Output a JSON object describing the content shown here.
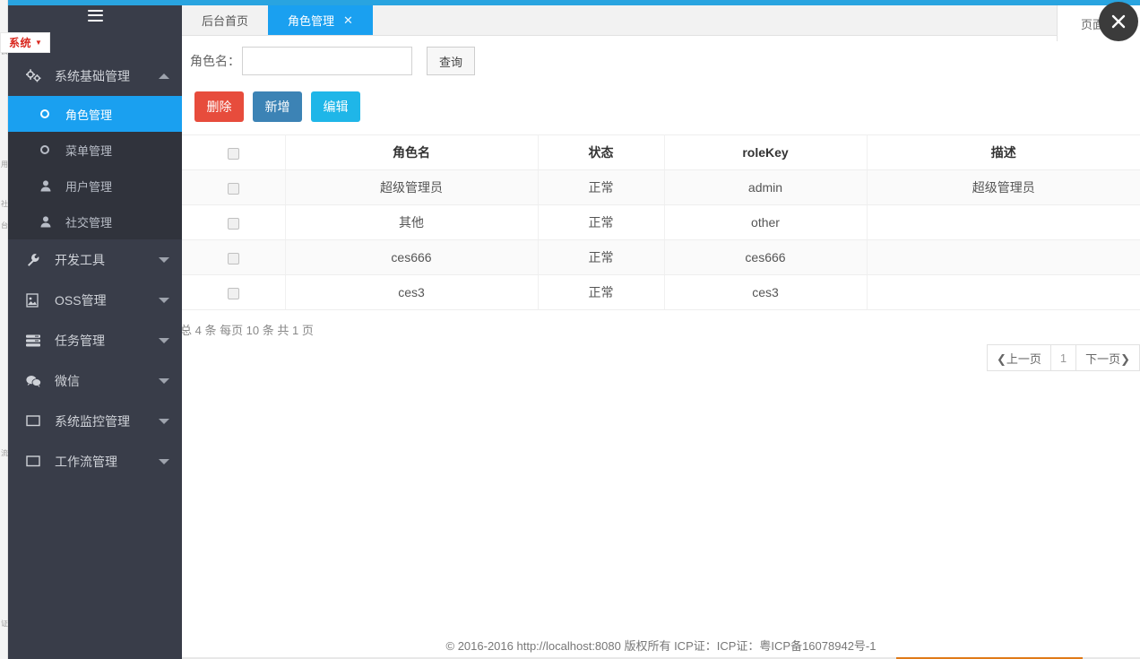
{
  "sidebar": {
    "hamburger_icon": "hamburger-icon",
    "badge": {
      "label": "系统",
      "caret": "▼"
    },
    "groups": [
      {
        "label": "系统基础管理",
        "icon": "gears-icon",
        "expanded": true,
        "arrow": "up",
        "items": [
          {
            "label": "角色管理",
            "icon": "ring-icon",
            "active": true
          },
          {
            "label": "菜单管理",
            "icon": "ring-icon",
            "active": false
          },
          {
            "label": "用户管理",
            "icon": "user-icon",
            "active": false
          },
          {
            "label": "社交管理",
            "icon": "user-icon",
            "active": false
          }
        ]
      },
      {
        "label": "开发工具",
        "icon": "wrench-icon",
        "expanded": false,
        "arrow": "down",
        "items": []
      },
      {
        "label": "OSS管理",
        "icon": "image-icon",
        "expanded": false,
        "arrow": "down",
        "items": []
      },
      {
        "label": "任务管理",
        "icon": "list-icon",
        "expanded": false,
        "arrow": "down",
        "items": []
      },
      {
        "label": "微信",
        "icon": "wechat-icon",
        "expanded": false,
        "arrow": "down",
        "items": []
      },
      {
        "label": "系统监控管理",
        "icon": "monitor-icon",
        "expanded": false,
        "arrow": "down",
        "items": []
      },
      {
        "label": "工作流管理",
        "icon": "monitor-icon",
        "expanded": false,
        "arrow": "down",
        "items": []
      }
    ]
  },
  "tabs": [
    {
      "label": "后台首页",
      "active": false,
      "closable": false
    },
    {
      "label": "角色管理",
      "active": true,
      "closable": true,
      "close_glyph": "✕"
    }
  ],
  "tabbar_right_label": "页面操作",
  "close_overlay": {
    "name": "close-overlay-button",
    "glyph": "✕"
  },
  "search": {
    "label": "角色名：",
    "value": "",
    "placeholder": "",
    "button_label": "查询"
  },
  "actions": [
    {
      "label": "删除",
      "color": "#e74c3c",
      "name": "delete-button"
    },
    {
      "label": "新增",
      "color": "#3c83b5",
      "name": "add-button"
    },
    {
      "label": "编辑",
      "color": "#1fb6e8",
      "name": "edit-button"
    }
  ],
  "table": {
    "columns": [
      "",
      "角色名",
      "状态",
      "roleKey",
      "描述"
    ],
    "rows": [
      {
        "checked": false,
        "name": "超级管理员",
        "state": "正常",
        "roleKey": "admin",
        "desc": "超级管理员"
      },
      {
        "checked": false,
        "name": "其他",
        "state": "正常",
        "roleKey": "other",
        "desc": ""
      },
      {
        "checked": false,
        "name": "ces666",
        "state": "正常",
        "roleKey": "ces666",
        "desc": ""
      },
      {
        "checked": false,
        "name": "ces3",
        "state": "正常",
        "roleKey": "ces3",
        "desc": ""
      }
    ]
  },
  "page_info": "总 4 条 每页 10 条 共 1 页",
  "pager": {
    "prev": "❮上一页",
    "current": "1",
    "next": "下一页❯"
  },
  "footer": "© 2016-2016 http://localhost:8080 版权所有 ICP证：ICP证：粤ICP备16078942号-1",
  "colors": {
    "sidebar_bg": "#393d49",
    "submenu_bg": "#30333c",
    "accent_blue": "#1aa0f0",
    "top_strip": "#29a4e0",
    "badge_red": "#d9281f",
    "progress_orange": "#e07a18"
  }
}
